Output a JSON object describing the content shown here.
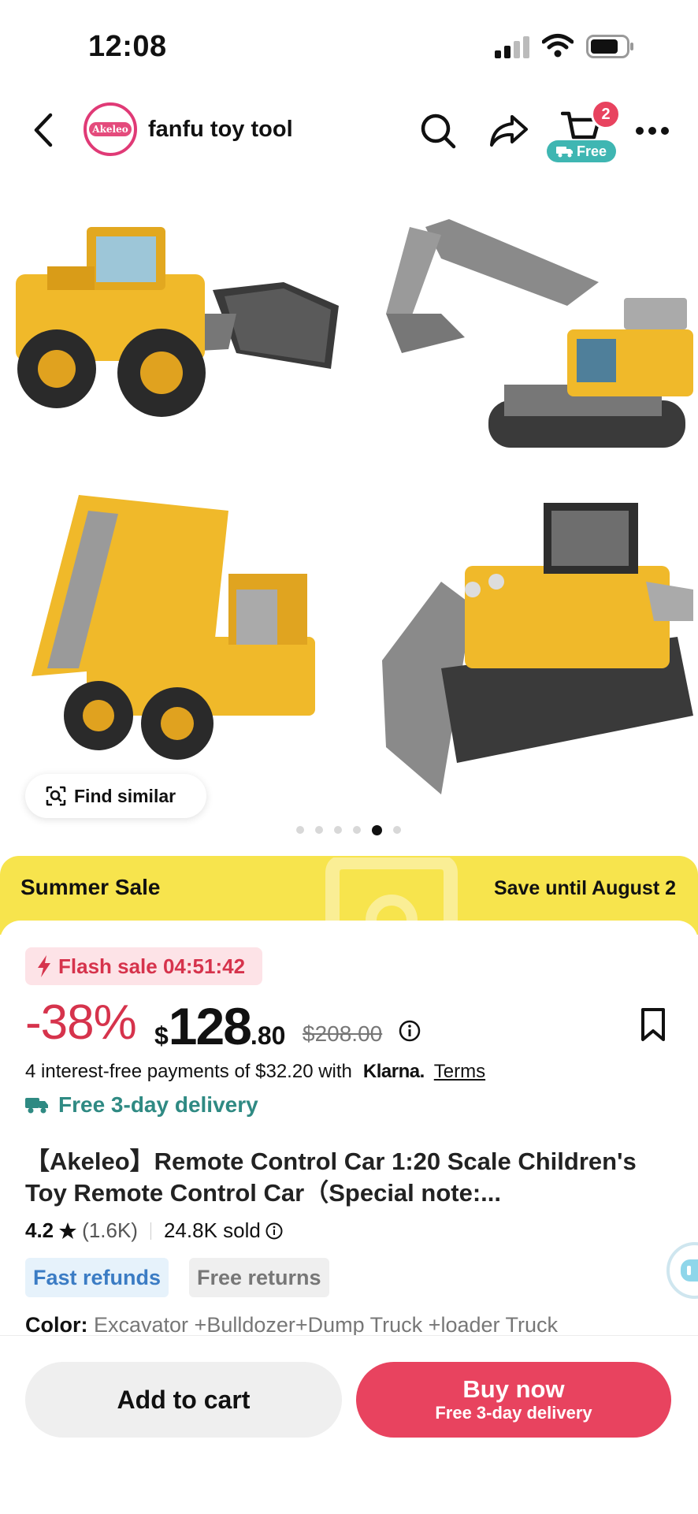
{
  "status_bar": {
    "time": "12:08"
  },
  "header": {
    "store_logo_text": "Akeleo",
    "store_name": "fanfu toy tool",
    "cart_count": "2",
    "cart_free_label": "Free"
  },
  "gallery": {
    "images": [
      "wheel-loader",
      "excavator",
      "dump-truck",
      "bulldozer"
    ],
    "find_similar_label": "Find similar",
    "dots_count": 6,
    "active_dot": 4
  },
  "banner": {
    "title": "Summer Sale",
    "save_text": "Save until August 2",
    "color": "#f7e44d"
  },
  "product": {
    "flash_sale_label": "Flash sale 04:51:42",
    "discount": "-38%",
    "price_currency": "$",
    "price_main": "128",
    "price_cents": ".80",
    "old_price": "$208.00",
    "installments_text": "4 interest-free payments of $32.20 with",
    "klarna_label": "Klarna.",
    "terms_label": "Terms",
    "delivery_label": "Free 3-day delivery",
    "title": "【Akeleo】Remote Control Car 1:20 Scale Children's Toy Remote Control Car（Special note:...",
    "rating": "4.2",
    "review_count": "(1.6K)",
    "sold": "24.8K sold",
    "tags": [
      "Fast refunds",
      "Free returns"
    ],
    "color_label": "Color:",
    "color_value": "Excavator +Bulldozer+Dump Truck +loader Truck"
  },
  "actions": {
    "add_to_cart": "Add to cart",
    "buy_now": "Buy now",
    "buy_now_sub": "Free 3-day delivery"
  },
  "colors": {
    "accent": "#e8435f",
    "sale_red": "#d6334c",
    "delivery_teal": "#2f8a83",
    "machine_yellow": "#f0b92a"
  }
}
